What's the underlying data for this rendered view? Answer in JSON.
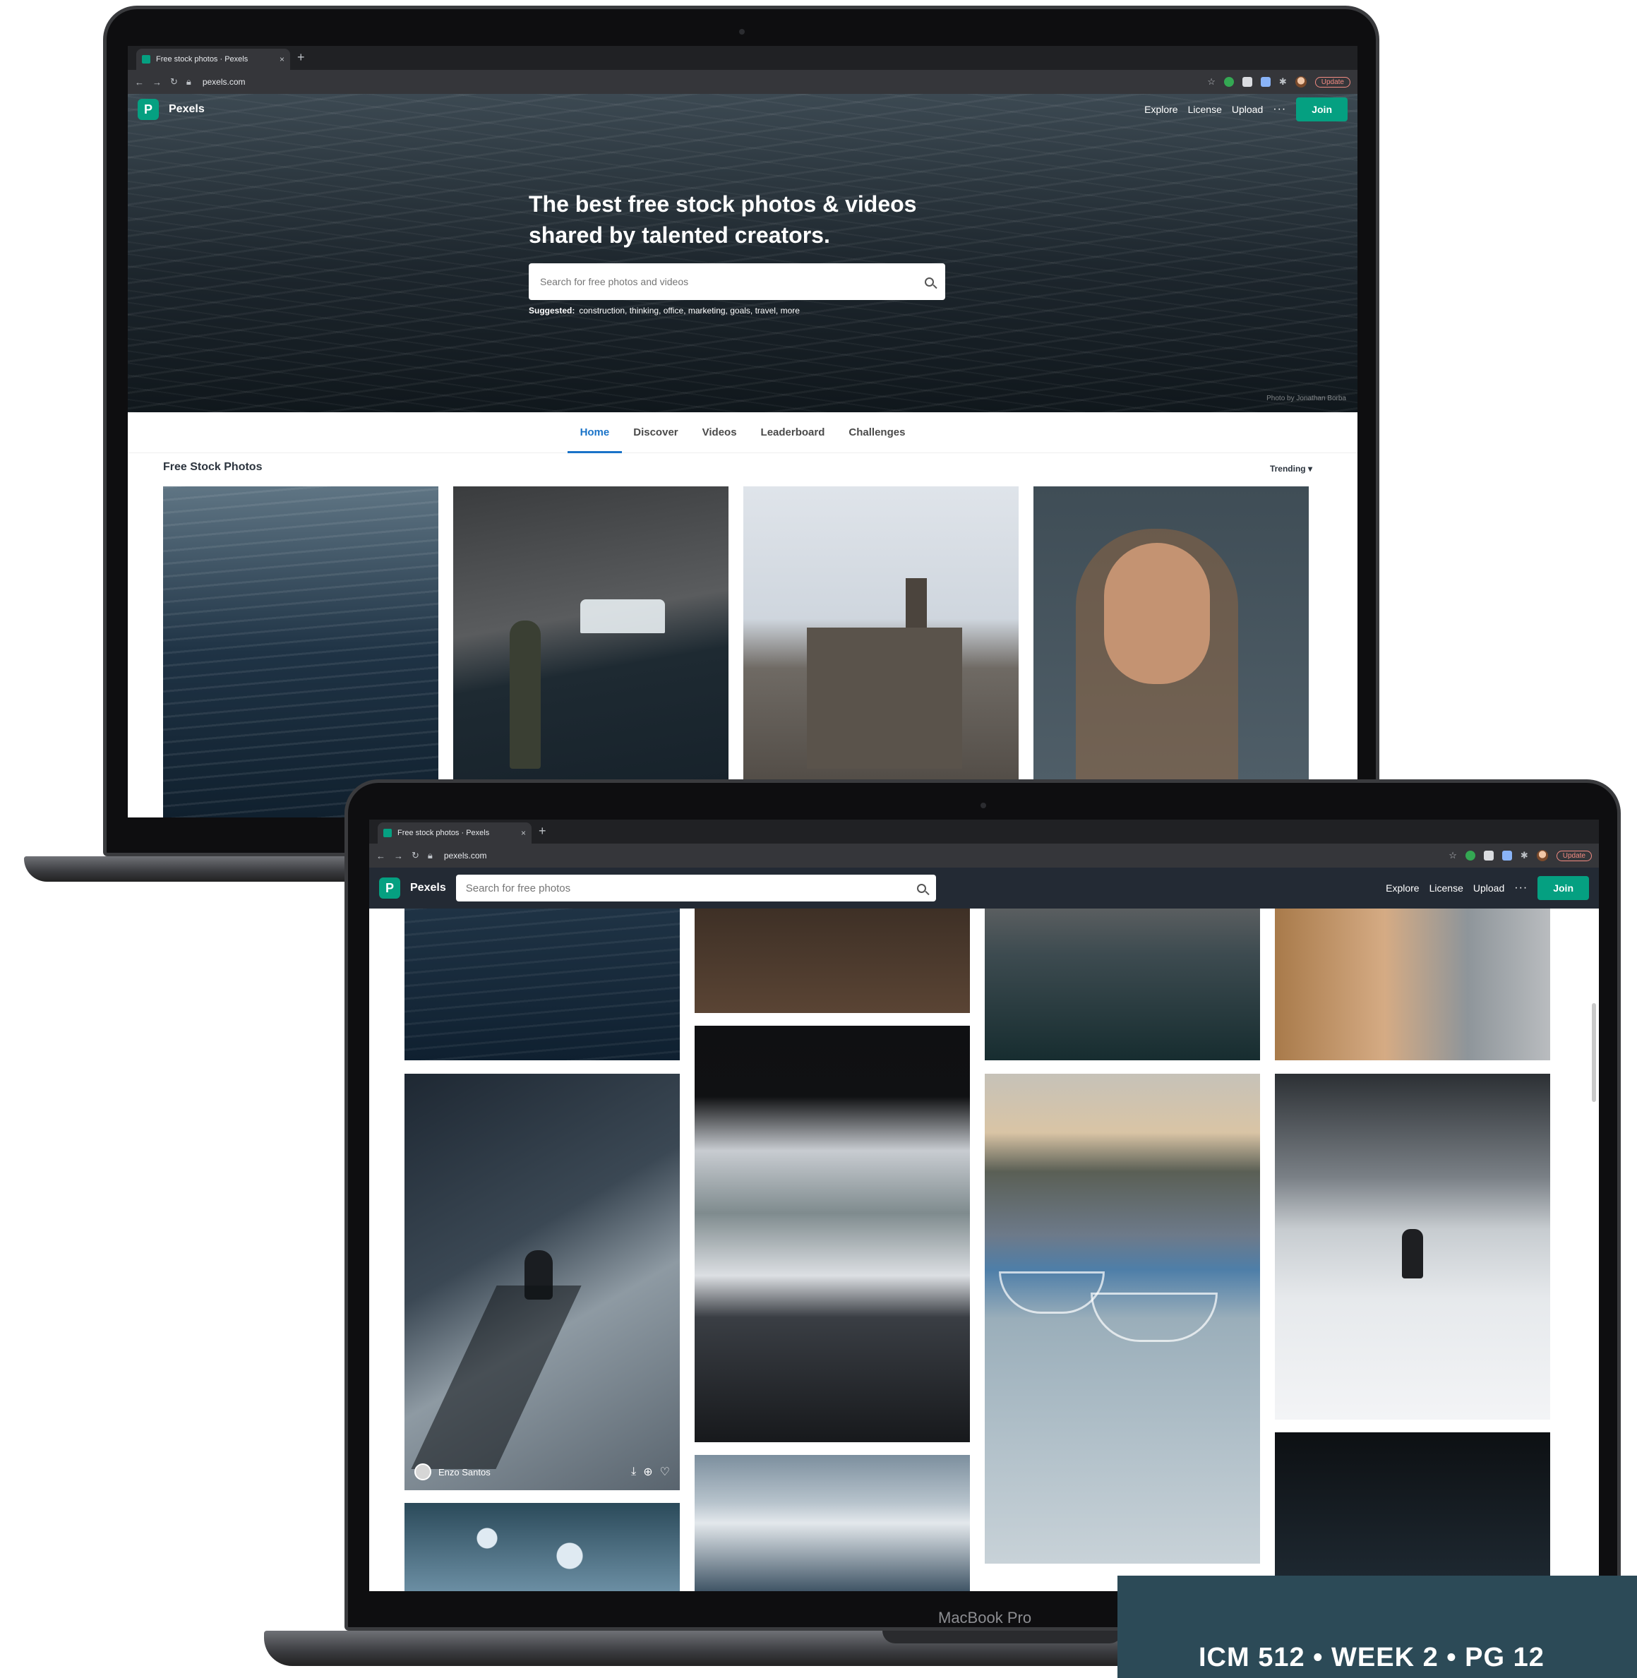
{
  "back_laptop": {
    "browser": {
      "tab_title": "Free stock photos · Pexels",
      "tab_close": "×",
      "new_tab": "+",
      "url": "pexels.com",
      "update_label": "Update"
    },
    "nav": {
      "logo_letter": "P",
      "brand": "Pexels",
      "links": [
        "Explore",
        "License",
        "Upload"
      ],
      "more": "···",
      "join": "Join"
    },
    "hero": {
      "title": "The best free stock photos & videos shared by talented creators.",
      "search_placeholder": "Search for free photos and videos",
      "suggested_label": "Suggested:",
      "suggested_terms": "construction, thinking, office, marketing, goals, travel, more",
      "credit": "Photo by Jonathan Borba"
    },
    "tabs": [
      "Home",
      "Discover",
      "Videos",
      "Leaderboard",
      "Challenges"
    ],
    "section_title": "Free Stock Photos",
    "sort": "Trending ▾"
  },
  "front_laptop": {
    "browser": {
      "tab_title": "Free stock photos · Pexels",
      "tab_close": "×",
      "new_tab": "+",
      "url": "pexels.com",
      "update_label": "Update"
    },
    "nav": {
      "logo_letter": "P",
      "brand": "Pexels",
      "search_placeholder": "Search for free photos",
      "links": [
        "Explore",
        "License",
        "Upload"
      ],
      "more": "···",
      "join": "Join"
    },
    "hover_card": {
      "photographer": "Enzo Santos"
    },
    "model": "MacBook Pro"
  },
  "caption": "ICM 512 • WEEK 2 • PG 12",
  "colors": {
    "pexels_green": "#05a081",
    "active_tab": "#1a73c8",
    "caption_bg": "#2c4a57"
  }
}
